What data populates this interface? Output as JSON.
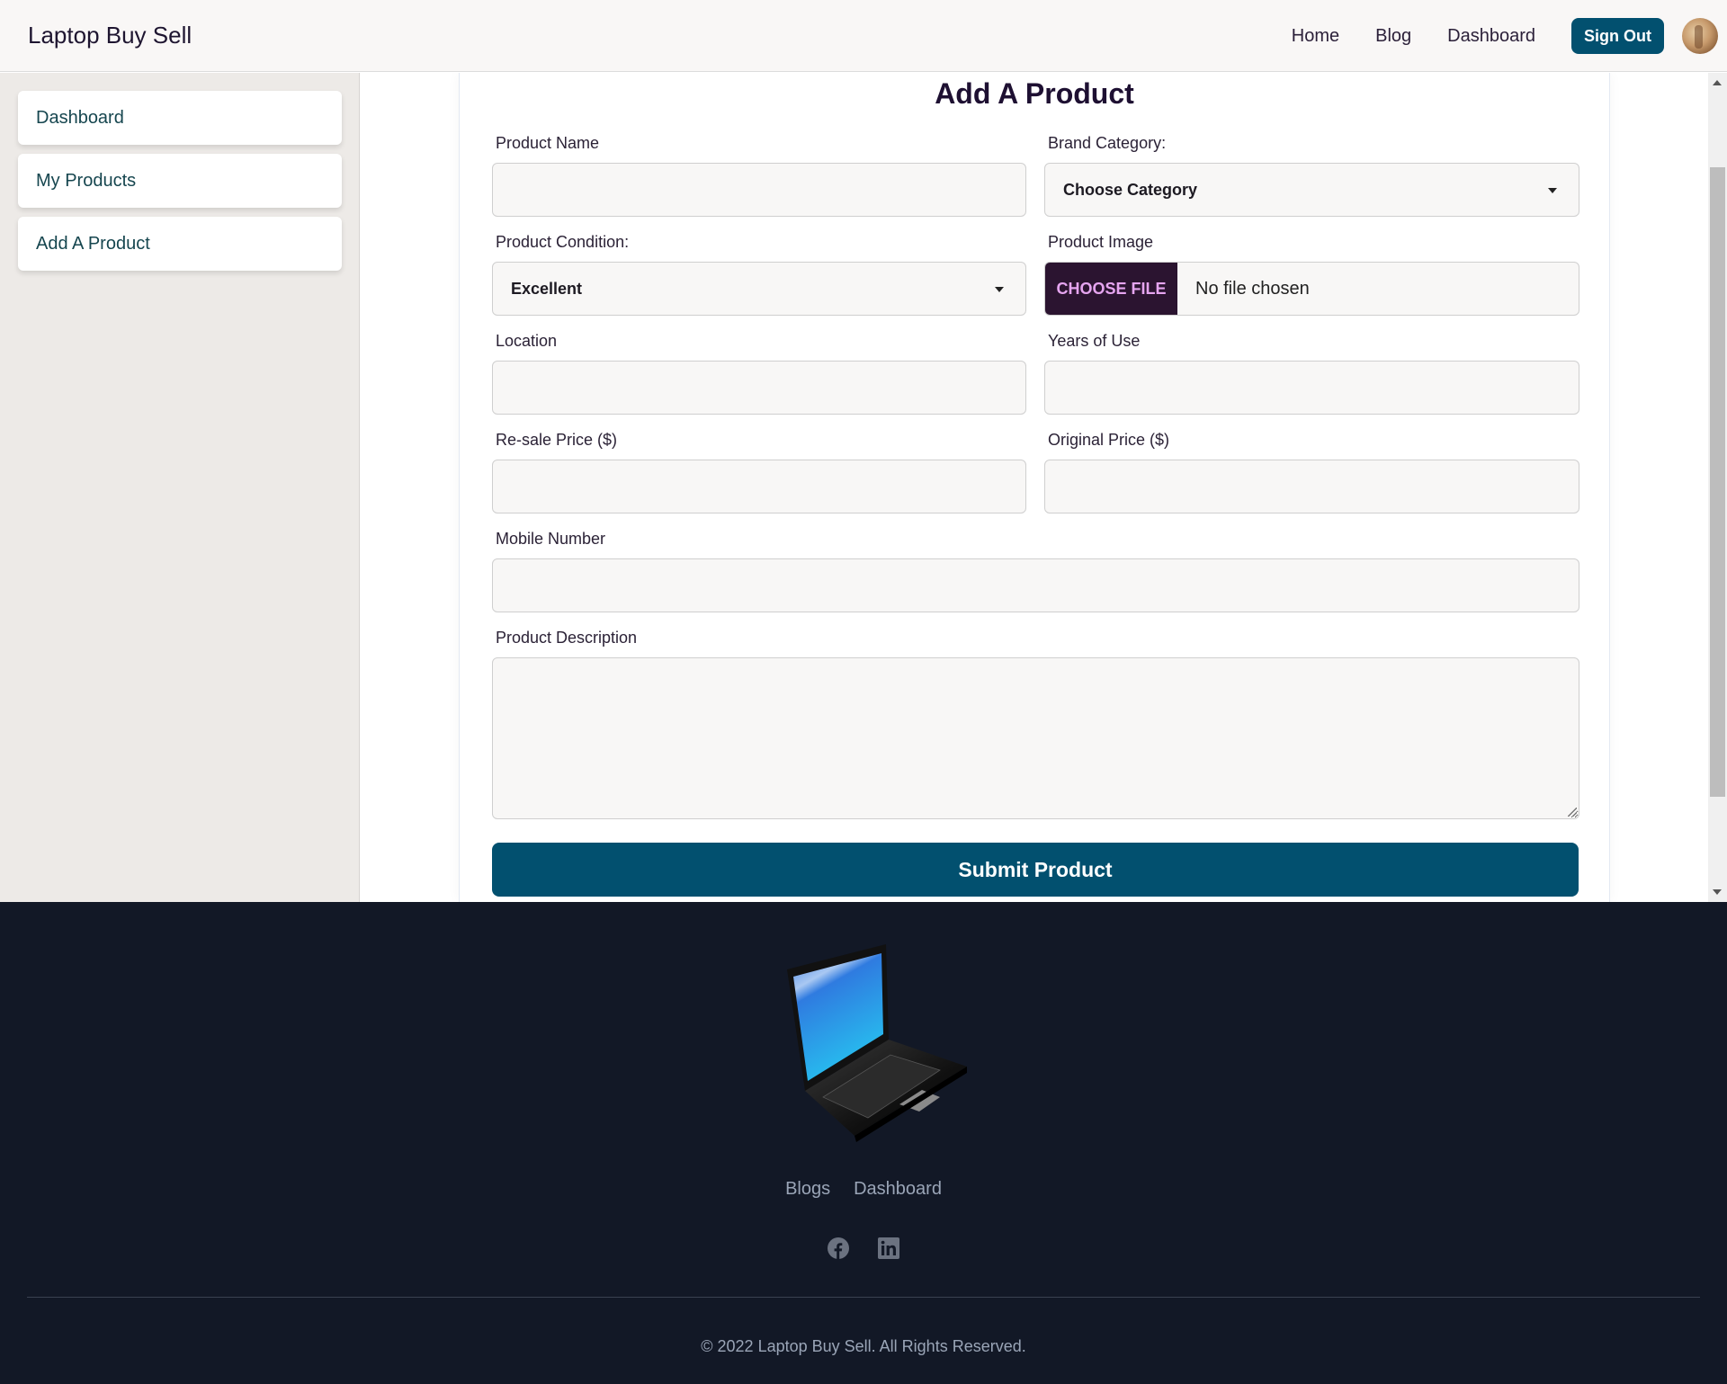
{
  "header": {
    "brand": "Laptop Buy Sell",
    "nav": [
      {
        "label": "Home"
      },
      {
        "label": "Blog"
      },
      {
        "label": "Dashboard"
      }
    ],
    "sign_out_label": "Sign Out",
    "avatar": "user-avatar-icon"
  },
  "sidebar": {
    "items": [
      {
        "label": "Dashboard"
      },
      {
        "label": "My Products"
      },
      {
        "label": "Add A Product"
      }
    ]
  },
  "form": {
    "title": "Add A Product",
    "product_name": {
      "label": "Product Name",
      "value": "",
      "placeholder": ""
    },
    "brand_category": {
      "label": "Brand Category:",
      "selected": "Choose Category"
    },
    "product_condition": {
      "label": "Product Condition:",
      "selected": "Excellent"
    },
    "product_image": {
      "label": "Product Image",
      "button_label": "CHOOSE FILE",
      "status": "No file chosen"
    },
    "location": {
      "label": "Location",
      "value": "",
      "placeholder": ""
    },
    "years_of_use": {
      "label": "Years of Use",
      "value": "",
      "placeholder": ""
    },
    "resale_price": {
      "label": "Re-sale Price ($)",
      "value": "",
      "placeholder": ""
    },
    "original_price": {
      "label": "Original Price ($)",
      "value": "",
      "placeholder": ""
    },
    "mobile_number": {
      "label": "Mobile Number",
      "value": "",
      "placeholder": ""
    },
    "product_description": {
      "label": "Product Description",
      "value": "",
      "placeholder": ""
    },
    "submit_label": "Submit Product"
  },
  "footer": {
    "logo": "laptop-logo-icon",
    "links": [
      {
        "label": "Blogs"
      },
      {
        "label": "Dashboard"
      }
    ],
    "socials": [
      "facebook-icon",
      "linkedin-icon"
    ],
    "copyright": "© 2022 Laptop Buy Sell. All Rights Reserved."
  },
  "colors": {
    "primary": "#02506f",
    "file_button_bg": "#2b1430",
    "file_button_text": "#e6a5f0",
    "footer_bg": "#121826",
    "sidebar_bg": "#edeae7"
  }
}
